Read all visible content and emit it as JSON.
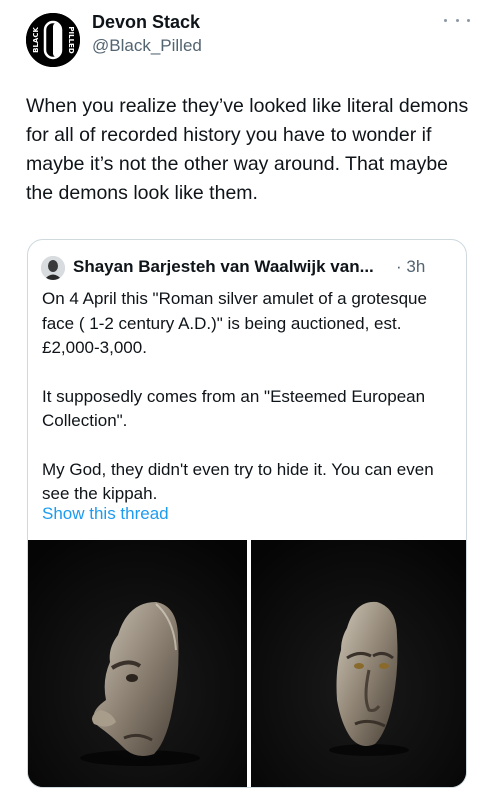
{
  "tweet": {
    "author_name": "Devon Stack",
    "author_handle": "@Black_Pilled",
    "avatar_text_left": "BLACK",
    "avatar_text_right": "PILLED",
    "text": "When you realize they’ve looked like literal demons for all of recorded history you have to wonder if maybe it’s not the other way around. That maybe the demons look like them."
  },
  "quote": {
    "author_name": "Shayan Barjesteh van Waalwijk van...",
    "time": "· 3h",
    "paragraphs": [
      "On 4 April this \"Roman silver amulet of a grotesque face ( 1-2 century A.D.)\" is being auctioned, est. £2,000-3,000.",
      "It supposedly comes from an \"Esteemed European Collection\".",
      "My God, they didn't even try to hide it. You can even see the kippah."
    ],
    "link": "Show this thread"
  },
  "colors": {
    "text": "#0f1419",
    "secondary": "#536471",
    "link": "#1d9bf0",
    "border": "#cfd9de"
  }
}
